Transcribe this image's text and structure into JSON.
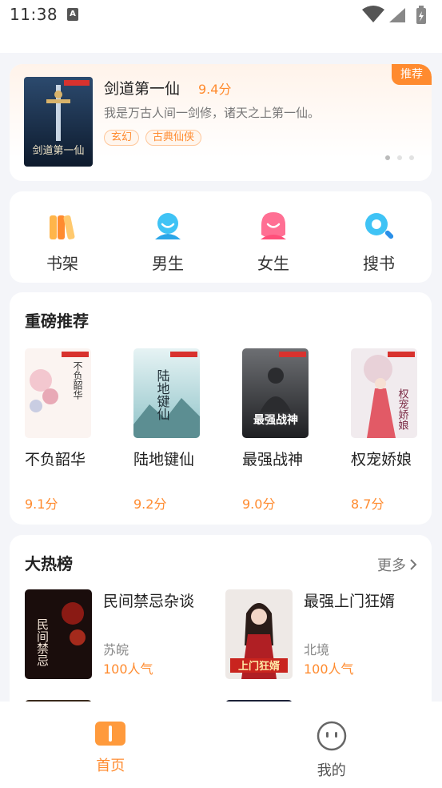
{
  "status_bar": {
    "time": "11:38",
    "sim_label": "A"
  },
  "banner": {
    "tag": "推荐",
    "title": "剑道第一仙",
    "score": "9.4分",
    "description": "我是万古人间一剑修，诸天之上第一仙。",
    "chips": [
      "玄幻",
      "古典仙侠"
    ],
    "cover_text": "剑道第一仙"
  },
  "categories": [
    {
      "label": "书架",
      "icon": "bookshelf-icon"
    },
    {
      "label": "男生",
      "icon": "male-icon"
    },
    {
      "label": "女生",
      "icon": "female-icon"
    },
    {
      "label": "搜书",
      "icon": "search-icon"
    }
  ],
  "recommend": {
    "title": "重磅推荐",
    "books": [
      {
        "name": "不负韶华",
        "score": "9.1分",
        "cover_text": "不负韶华"
      },
      {
        "name": "陆地键仙",
        "score": "9.2分",
        "cover_text": "陆地键仙"
      },
      {
        "name": "最强战神",
        "score": "9.0分",
        "cover_text": "最强战神"
      },
      {
        "name": "权宠娇娘",
        "score": "8.7分",
        "cover_text": "权宠娇娘"
      }
    ]
  },
  "hot": {
    "title": "大热榜",
    "more": "更多",
    "books": [
      {
        "name": "民间禁忌杂谈",
        "author": "苏皖",
        "popularity": "100人气",
        "cover_text": "民间禁忌"
      },
      {
        "name": "最强上门狂婿",
        "author": "北境",
        "popularity": "100人气",
        "cover_text": "上门狂婿"
      }
    ]
  },
  "tabs": [
    {
      "label": "首页",
      "icon": "home-icon",
      "active": true
    },
    {
      "label": "我的",
      "icon": "profile-icon",
      "active": false
    }
  ],
  "colors": {
    "accent": "#ff8b2f",
    "background": "#f4f5f9"
  }
}
